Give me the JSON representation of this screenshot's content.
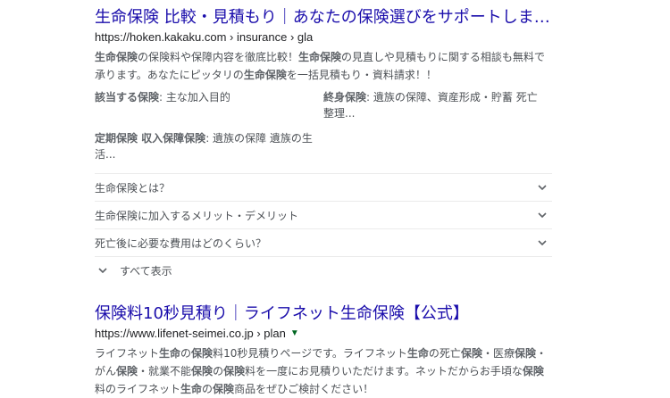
{
  "result1": {
    "title": "生命保険 比較・見積もり｜あなたの保険選びをサポートします ...",
    "url": "https://hoken.kakaku.com › insurance › gla",
    "snippet": [
      {
        "t": "生命保険",
        "b": true
      },
      {
        "t": "の保険料や保障内容を徹底比較！",
        "b": false
      },
      {
        "t": "生命保険",
        "b": true
      },
      {
        "t": "の見直しや見積もりに関する相談も無料で承ります。あなたにピッタリの",
        "b": false
      },
      {
        "t": "生命保険",
        "b": true
      },
      {
        "t": "を一括見積もり・資料請求！！",
        "b": false
      }
    ],
    "facts": [
      {
        "label": "該当する保険",
        "value": ": 主な加入目的"
      },
      {
        "label": "終身保険",
        "value": ": 遺族の保障、資産形成・貯蓄 死亡整理..."
      },
      {
        "label": "定期保険 収入保障保険",
        "value": ": 遺族の保障 遺族の生活..."
      }
    ],
    "faq": [
      "生命保険とは？",
      "生命保険に加入するメリット・デメリット",
      "死亡後に必要な費用はどのくらい？"
    ],
    "show_all": "すべて表示"
  },
  "result2": {
    "title": "保険料10秒見積り｜ライフネット生命保険【公式】",
    "url": "https://www.lifenet-seimei.co.jp › plan",
    "snippet": [
      {
        "t": "ライフネット",
        "b": false
      },
      {
        "t": "生命",
        "b": true
      },
      {
        "t": "の",
        "b": false
      },
      {
        "t": "保険",
        "b": true
      },
      {
        "t": "料10秒見積りページです。ライフネット",
        "b": false
      },
      {
        "t": "生命",
        "b": true
      },
      {
        "t": "の死亡",
        "b": false
      },
      {
        "t": "保険",
        "b": true
      },
      {
        "t": "・医療",
        "b": false
      },
      {
        "t": "保険",
        "b": true
      },
      {
        "t": "・がん",
        "b": false
      },
      {
        "t": "保険",
        "b": true
      },
      {
        "t": "・就業不能",
        "b": false
      },
      {
        "t": "保険",
        "b": true
      },
      {
        "t": "の",
        "b": false
      },
      {
        "t": "保険",
        "b": true
      },
      {
        "t": "料を一度にお見積りいただけます。ネットだからお手頃な",
        "b": false
      },
      {
        "t": "保険",
        "b": true
      },
      {
        "t": "料のライフネット",
        "b": false
      },
      {
        "t": "生命",
        "b": true
      },
      {
        "t": "の",
        "b": false
      },
      {
        "t": "保険",
        "b": true
      },
      {
        "t": "商品をぜひご検討ください！",
        "b": false
      }
    ]
  },
  "colors": {
    "link": "#1a0dab",
    "url": "#202124",
    "text": "#4d5156"
  }
}
